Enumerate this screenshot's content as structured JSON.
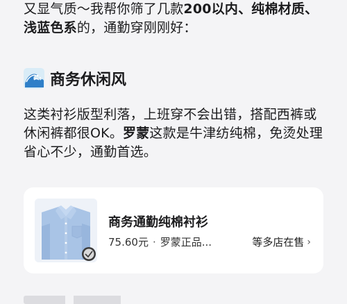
{
  "intro": {
    "part1": "又显气质～我帮你筛了几款",
    "bold1": "200以内、纯棉材质、浅蓝色系",
    "part2": "的，通勤穿刚刚好："
  },
  "section": {
    "icon": "wave-icon",
    "title": "商务休闲风"
  },
  "body": {
    "part1": "这类衬衫版型利落，上班穿不会出错，搭配西裤或休闲裤都很OK。",
    "bold1": "罗蒙",
    "part2": "这款是牛津纺纯棉，免烫处理省心不少，通勤首选。"
  },
  "product": {
    "title": "商务通勤纯棉衬衫",
    "price": "75.60元",
    "separator": "·",
    "shop": "罗蒙正品...",
    "more_label": "等多店在售",
    "chevron": "›"
  },
  "colors": {
    "background": "#f4f4f6",
    "card": "#ffffff",
    "shirt": "#a9c4e6"
  }
}
